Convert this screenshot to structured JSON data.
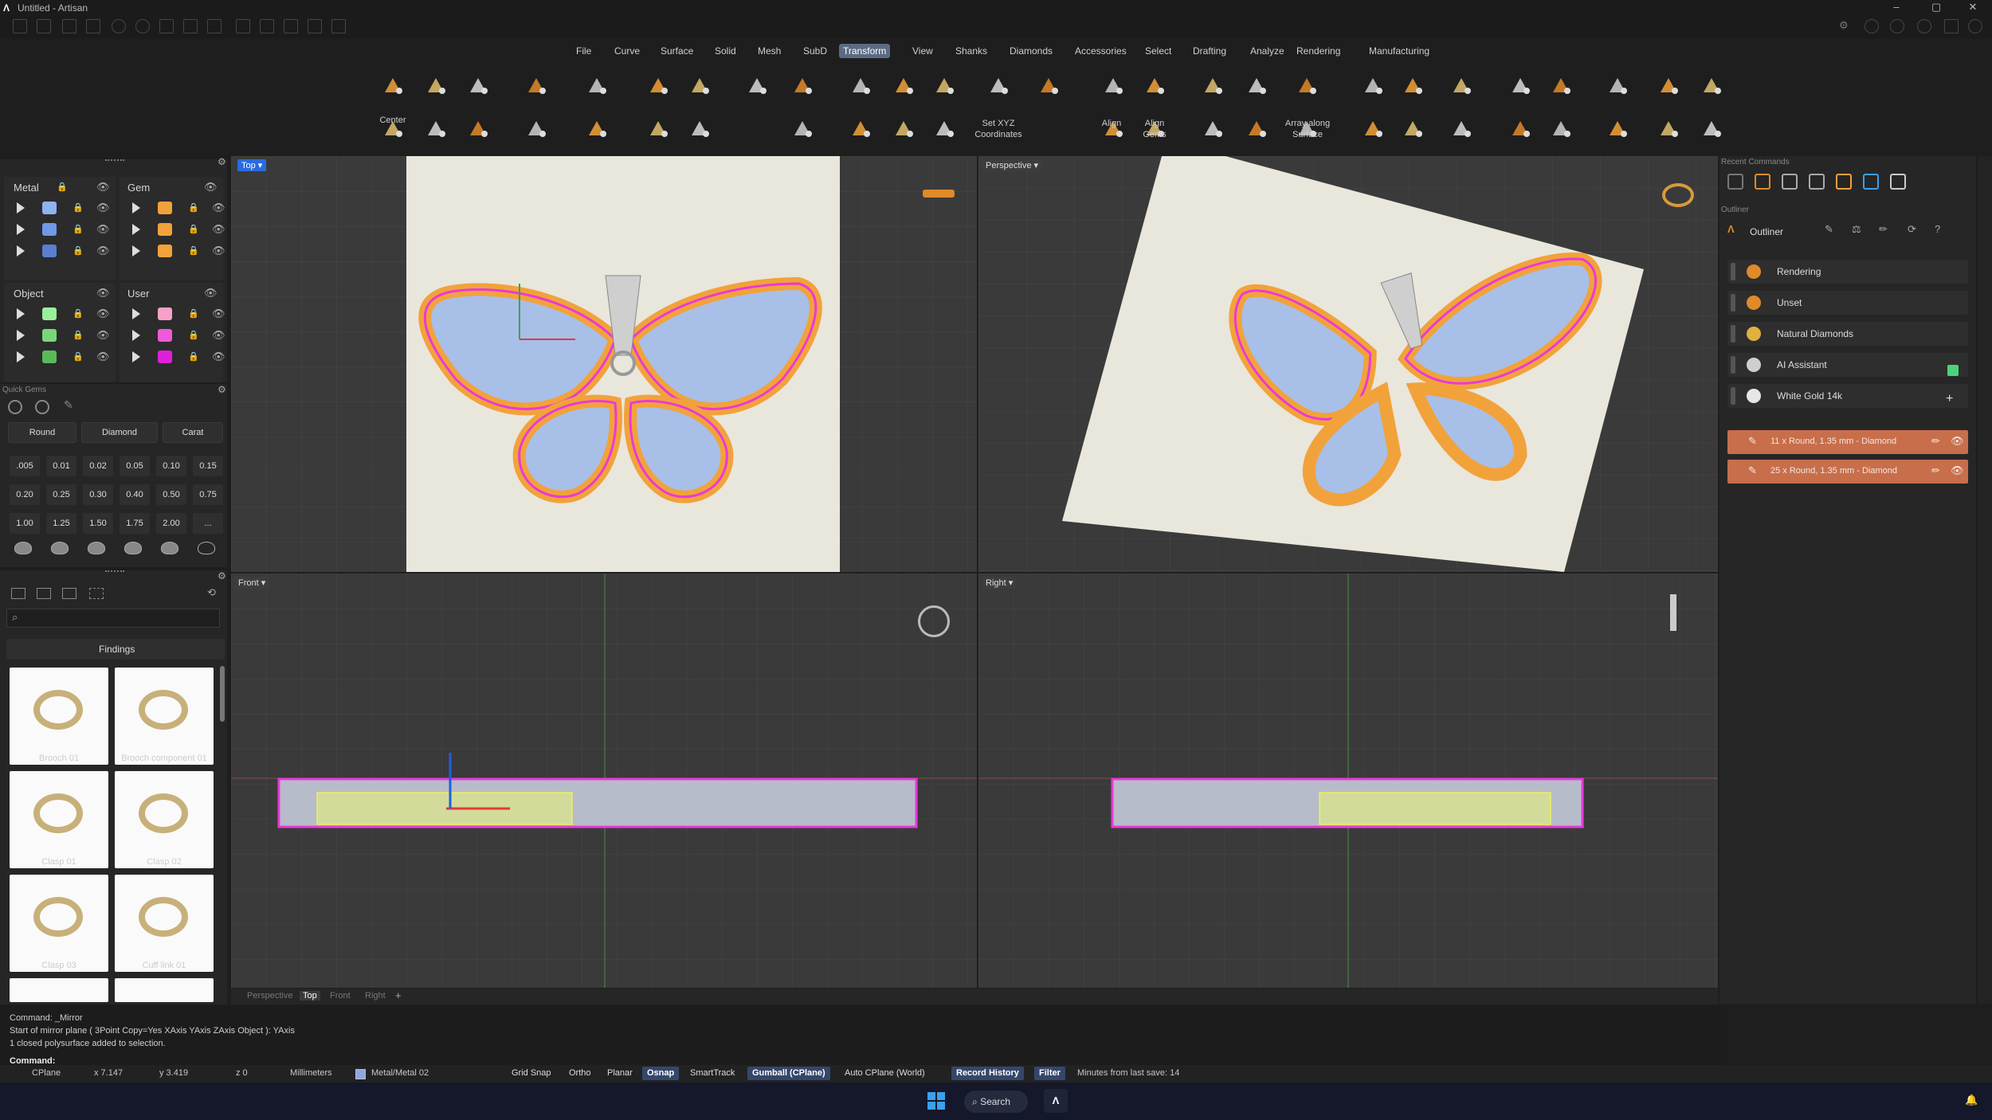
{
  "window": {
    "title": "Untitled - Artisan"
  },
  "menu": [
    "File",
    "Curve",
    "Surface",
    "Solid",
    "Mesh",
    "SubD",
    "Transform",
    "View",
    "Shanks",
    "Diamonds",
    "Accessories",
    "Select",
    "Drafting",
    "Analyze",
    "Rendering",
    "Manufacturing"
  ],
  "menu_active": "Transform",
  "toolbar": {
    "center": "Center",
    "set_xyz": "Set XYZ\nCoordinates",
    "align": "Align",
    "align_gems": "Align\nGems",
    "array_surface": "Array along\nSurface"
  },
  "layers": {
    "metal": "Metal",
    "gem": "Gem",
    "object": "Object",
    "user": "User"
  },
  "quick_gems": {
    "title": "Quick Gems",
    "round": "Round",
    "diamond": "Diamond",
    "carat": "Carat",
    "sizes": [
      ".005",
      "0.01",
      "0.02",
      "0.05",
      "0.10",
      "0.15",
      "0.20",
      "0.25",
      "0.30",
      "0.40",
      "0.50",
      "0.75",
      "1.00",
      "1.25",
      "1.50",
      "1.75",
      "2.00",
      "..."
    ]
  },
  "library": {
    "category": "Findings",
    "items": [
      "Brooch 01",
      "Brooch component 01",
      "Clasp 01",
      "Clasp 02",
      "Clasp 03",
      "Cuff link 01"
    ]
  },
  "viewports": {
    "top": "Top",
    "perspective": "Perspective",
    "front": "Front",
    "right": "Right"
  },
  "viewport_tabs": [
    "Perspective",
    "Top",
    "Front",
    "Right"
  ],
  "viewport_tab_active": "Top",
  "recent_commands": "Recent Commands",
  "outliner": {
    "section": "Outliner",
    "title": "Outliner",
    "items": [
      {
        "label": "Rendering",
        "color": "#e08a2a"
      },
      {
        "label": "Unset",
        "color": "#e08a2a"
      },
      {
        "label": "Natural Diamonds",
        "color": "#e0b040"
      },
      {
        "label": "AI Assistant",
        "color": "#cfcfcf"
      },
      {
        "label": "White Gold 14k",
        "color": "#e6e6e6"
      }
    ],
    "groups": [
      "11 x Round, 1.35 mm - Diamond",
      "25 x Round, 1.35 mm - Diamond"
    ]
  },
  "command_history": [
    "Command: _Mirror",
    "Start of mirror plane ( 3Point  Copy=Yes  XAxis  YAxis  ZAxis  Object ): YAxis",
    "1 closed polysurface added to selection."
  ],
  "command_prompt": "Command:",
  "status": {
    "cplane": "CPlane",
    "x": "x 7.147",
    "y": "y 3.419",
    "z": "z 0",
    "units": "Millimeters",
    "layer": "Metal/Metal 02",
    "toggles": [
      {
        "label": "Grid Snap",
        "on": false
      },
      {
        "label": "Ortho",
        "on": false
      },
      {
        "label": "Planar",
        "on": false
      },
      {
        "label": "Osnap",
        "on": true
      },
      {
        "label": "SmartTrack",
        "on": false
      },
      {
        "label": "Gumball (CPlane)",
        "on": true
      },
      {
        "label": "Auto CPlane (World)",
        "on": false
      },
      {
        "label": "Record History",
        "on": true
      },
      {
        "label": "Filter",
        "on": true
      }
    ],
    "save": "Minutes from last save: 14"
  },
  "taskbar": {
    "search": "Search"
  },
  "colors": {
    "accent": "#2a6ae0",
    "gem": "#f2a23a",
    "metal": "#8fa7e0",
    "selection": "#e83ad8",
    "history": "#c86e4b"
  }
}
